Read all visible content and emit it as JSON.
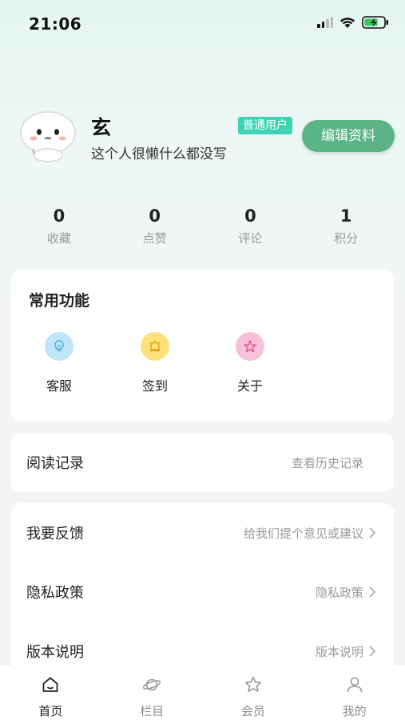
{
  "status_bar": {
    "time": "21:06"
  },
  "profile": {
    "name": "玄",
    "badge": "普通用户",
    "bio": "这个人很懒什么都没写",
    "edit_button": "编辑资料"
  },
  "stats": [
    {
      "value": "0",
      "label": "收藏"
    },
    {
      "value": "0",
      "label": "点赞"
    },
    {
      "value": "0",
      "label": "评论"
    },
    {
      "value": "1",
      "label": "积分"
    }
  ],
  "features": {
    "title": "常用功能",
    "items": [
      {
        "label": "客服",
        "icon": "customer-service-icon",
        "color": "#bfe6f8"
      },
      {
        "label": "签到",
        "icon": "sign-in-icon",
        "color": "#ffe37a"
      },
      {
        "label": "关于",
        "icon": "star-icon",
        "color": "#f9c0da"
      }
    ]
  },
  "history": {
    "label": "阅读记录",
    "value": "查看历史记录"
  },
  "settings": [
    {
      "label": "我要反馈",
      "value": "给我们提个意见或建议"
    },
    {
      "label": "隐私政策",
      "value": "隐私政策"
    },
    {
      "label": "版本说明",
      "value": "版本说明"
    }
  ],
  "tabbar": [
    {
      "label": "首页",
      "icon": "home-icon",
      "active": true
    },
    {
      "label": "栏目",
      "icon": "planet-icon",
      "active": false
    },
    {
      "label": "会员",
      "icon": "star-icon",
      "active": false
    },
    {
      "label": "我的",
      "icon": "user-icon",
      "active": false
    }
  ],
  "colors": {
    "accent": "#5ab488",
    "badge": "#3ed3b2"
  }
}
